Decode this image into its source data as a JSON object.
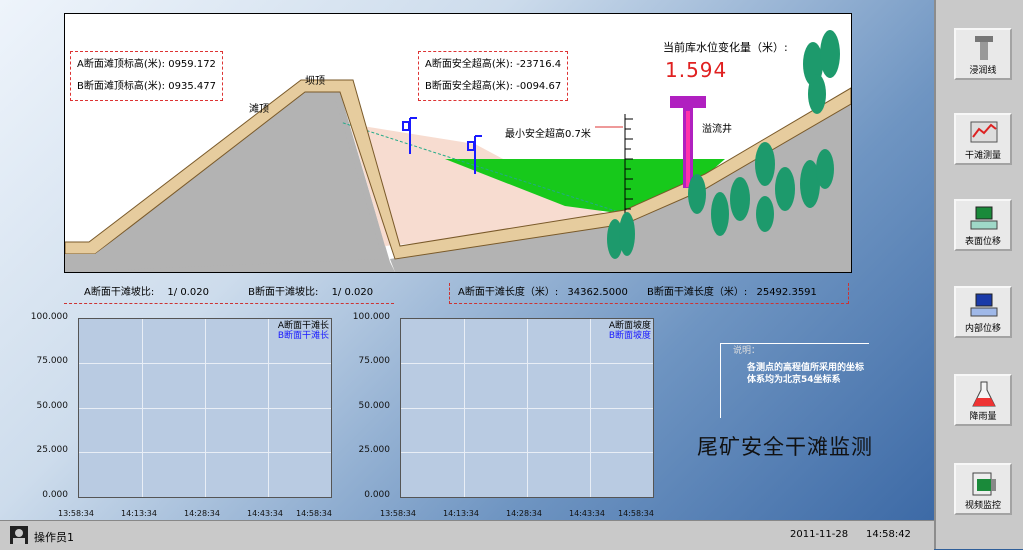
{
  "scene": {
    "box_left": {
      "a_label": "A断面滩顶标高(米):",
      "a_value": "0959.172",
      "b_label": "B断面滩顶标高(米):",
      "b_value": "0935.477"
    },
    "box_mid": {
      "a_label": "A断面安全超高(米):",
      "a_value": "-23716.4",
      "b_label": "B断面安全超高(米):",
      "b_value": "-0094.67"
    },
    "dam_top_label": "坝顶",
    "beach_top_label": "滩顶",
    "min_safety_label": "最小安全超高0.7米",
    "overflow_label": "溢流井",
    "water_change_label": "当前库水位变化量（米）:",
    "water_change_value": "1.594",
    "colors": {
      "sky": "#ffffff",
      "ground": "#b3b3b3",
      "dam_fill": "#e6cc9e",
      "slurry": "#f7dcd0",
      "water": "#17c91b",
      "tree": "#1d9a6c",
      "well": "#b020c0"
    }
  },
  "stats": {
    "a_ratio_label": "A断面干滩坡比:",
    "a_ratio_value": "1/ 0.020",
    "b_ratio_label": "B断面干滩坡比:",
    "b_ratio_value": "1/ 0.020",
    "a_len_label": "A断面干滩长度（米）:",
    "a_len_value": "34362.5000",
    "b_len_label": "B断面干滩长度（米）:",
    "b_len_value": "25492.3591"
  },
  "chart_data": [
    {
      "type": "line",
      "y_ticks": [
        "100.000",
        "75.000",
        "50.000",
        "25.000",
        "0.000"
      ],
      "x_ticks": [
        "13:58:34",
        "14:13:34",
        "14:28:34",
        "14:43:34",
        "14:58:34"
      ],
      "ylim": [
        0,
        100
      ],
      "series": [
        {
          "name": "A断面干滩长",
          "color": "#000000",
          "values": []
        },
        {
          "name": "B断面干滩长",
          "color": "#1a1aff",
          "values": []
        }
      ],
      "grid": true,
      "legend": "top-right"
    },
    {
      "type": "line",
      "y_ticks": [
        "100.000",
        "75.000",
        "50.000",
        "25.000",
        "0.000"
      ],
      "x_ticks": [
        "13:58:34",
        "14:13:34",
        "14:28:34",
        "14:43:34",
        "14:58:34"
      ],
      "ylim": [
        0,
        100
      ],
      "series": [
        {
          "name": "A断面坡度",
          "color": "#000000",
          "values": []
        },
        {
          "name": "B断面坡度",
          "color": "#1a1aff",
          "values": []
        }
      ],
      "grid": true,
      "legend": "top-right"
    }
  ],
  "note": {
    "title": "说明：",
    "text": "各测点的高程值所采用的坐标体系均为北京54坐标系"
  },
  "page_title": "尾矿安全干滩监测",
  "sidebar": {
    "items": [
      {
        "label": "浸润线",
        "icon": "pipe-icon"
      },
      {
        "label": "干滩测量",
        "icon": "graph-icon"
      },
      {
        "label": "表面位移",
        "icon": "monitor-green-icon"
      },
      {
        "label": "内部位移",
        "icon": "monitor-blue-icon"
      },
      {
        "label": "降雨量",
        "icon": "flask-icon"
      },
      {
        "label": "视频监控",
        "icon": "camera-icon"
      }
    ]
  },
  "status": {
    "user": "操作员1",
    "date": "2011-11-28",
    "time": "14:58:42"
  }
}
